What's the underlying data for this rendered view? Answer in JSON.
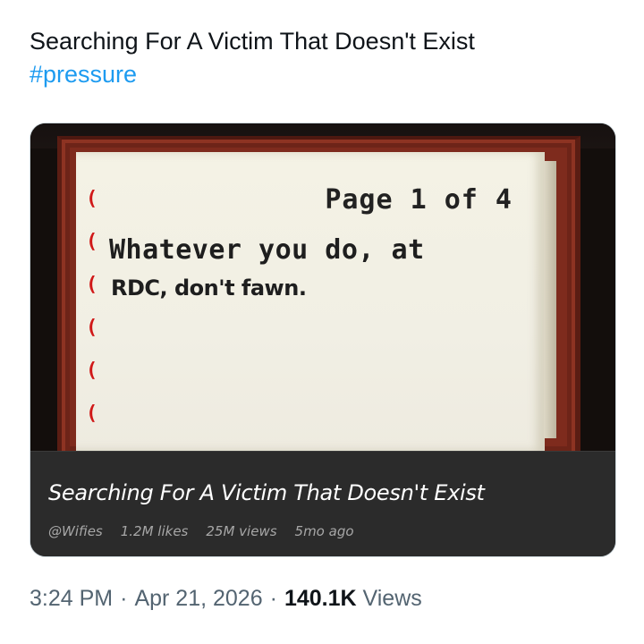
{
  "tweet": {
    "text": "Searching For A Victim That Doesn't Exist",
    "hashtag": "#pressure"
  },
  "media": {
    "note": {
      "page_label": "Page 1 of 4",
      "line1": "Whatever you do, at",
      "line2": "RDC, don't fawn."
    },
    "caption": {
      "title": "Searching For A Victim That Doesn't Exist",
      "author": "@Wifies",
      "likes": "1.2M likes",
      "views": "25M views",
      "age": "5mo ago"
    }
  },
  "footer": {
    "time": "3:24 PM",
    "separator": "·",
    "date": "Apr 21, 2026",
    "views_count": "140.1K",
    "views_label": "Views"
  }
}
